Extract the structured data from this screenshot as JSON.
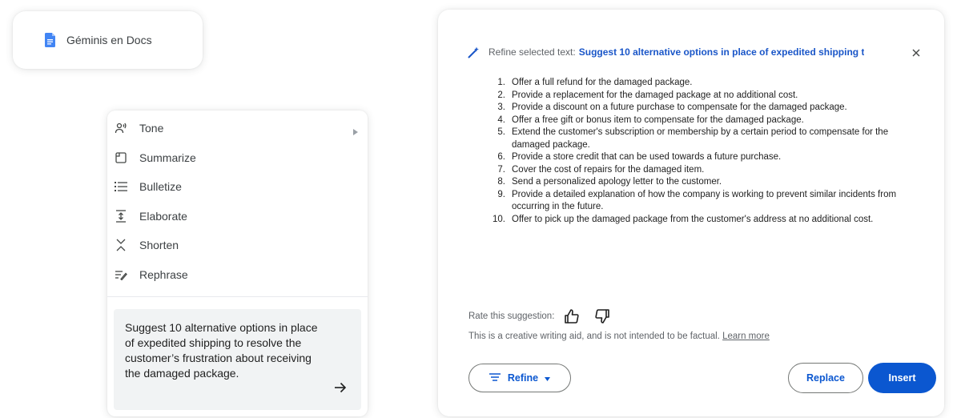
{
  "chip": {
    "label": "Géminis en Docs",
    "icon": "google-docs-icon"
  },
  "menu": {
    "items": [
      {
        "label": "Tone",
        "icon": "tone-icon",
        "has_submenu": true
      },
      {
        "label": "Summarize",
        "icon": "summarize-icon"
      },
      {
        "label": "Bulletize",
        "icon": "bulletize-icon"
      },
      {
        "label": "Elaborate",
        "icon": "elaborate-icon"
      },
      {
        "label": "Shorten",
        "icon": "shorten-icon"
      },
      {
        "label": "Rephrase",
        "icon": "rephrase-icon"
      }
    ],
    "prompt": "Suggest 10 alternative options in place of expedited shipping to resolve the customer’s frustration about receiving the damaged package.",
    "send_icon": "arrow-right-icon"
  },
  "panel": {
    "header_prefix": "Refine selected text:",
    "header_selected": "Suggest 10 alternative options in place of expedited shipping t",
    "close_icon": "close-icon",
    "suggestions": [
      {
        "num": "1.",
        "text": "Offer a full refund for the damaged package."
      },
      {
        "num": "2.",
        "text": "Provide a replacement for the damaged package at no additional cost."
      },
      {
        "num": "3.",
        "text": "Provide a discount on a future purchase to compensate for the damaged package."
      },
      {
        "num": "4.",
        "text": "Offer a free gift or bonus item to compensate for the damaged package."
      },
      {
        "num": "5.",
        "text": "Extend the customer's subscription or membership by a certain period to compensate for the damaged package."
      },
      {
        "num": "6.",
        "text": "Provide a store credit that can be used towards a future purchase."
      },
      {
        "num": "7.",
        "text": "Cover the cost of repairs for the damaged item."
      },
      {
        "num": "8.",
        "text": "Send a personalized apology letter to the customer."
      },
      {
        "num": "9.",
        "text": "Provide a detailed explanation of how the company is working to prevent similar incidents from occurring in the future."
      },
      {
        "num": "10.",
        "text": "Offer to pick up the damaged package from the customer's address at no additional cost."
      }
    ],
    "rate_label": "Rate this suggestion:",
    "disclaimer": "This is a creative writing aid, and is not intended to be factual.",
    "learn_more": "Learn more",
    "buttons": {
      "refine": "Refine",
      "replace": "Replace",
      "insert": "Insert"
    },
    "colors": {
      "accent": "#0b57d0",
      "docs_blue": "#4285f4"
    }
  }
}
